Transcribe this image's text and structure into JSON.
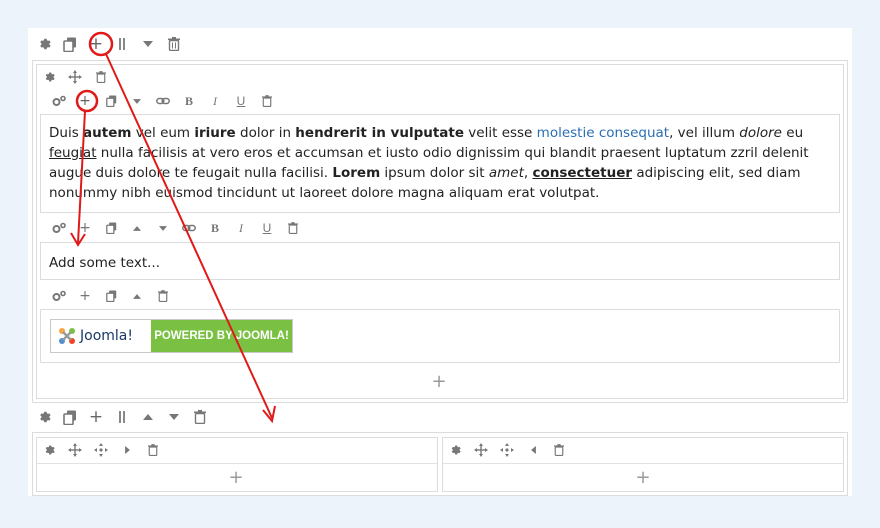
{
  "row_toolbar": [
    "gear-icon",
    "copy-icon",
    "plus-icon",
    "columns-icon",
    "caret-down-icon",
    "trash-icon"
  ],
  "column_toolbar": [
    "gear-icon",
    "move-icon",
    "trash-icon"
  ],
  "text_block": {
    "p1": "Duis ",
    "b1": "autem",
    "p2": " vel eum ",
    "b2": "iriure",
    "p3": " dolor in ",
    "b3": "hendrerit in vulputate",
    "p4": " velit esse ",
    "link": "molestie consequat",
    "p5": ", vel illum ",
    "i1": "dolore",
    "p6": " eu ",
    "u1": "feugiat",
    "p7": " nulla facilisis at vero eros et accumsan et iusto odio dignissim qui blandit praesent luptatum zzril delenit augue duis dolore te feugait nulla facilisi. ",
    "b4": "Lorem",
    "p8": " ipsum dolor sit ",
    "i2": "amet",
    "p9": ", ",
    "bu1": "consectetuer",
    "p10": " adipiscing elit, sed diam nonummy nibh euismod tincidunt ut laoreet dolore magna aliquam erat volutpat."
  },
  "placeholder_block": {
    "text": "Add some text..."
  },
  "joomla_badge": {
    "logo_text": "Joomla!",
    "label": "POWERED BY JOOMLA!",
    "color": "#7ac143"
  },
  "add_glyph": "+",
  "accent_annotation_color": "#e01919"
}
